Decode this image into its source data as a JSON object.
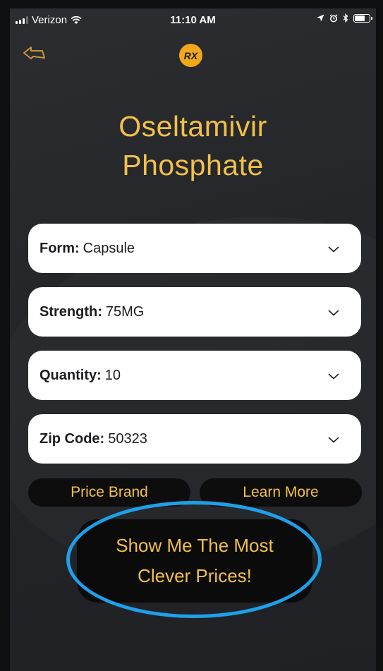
{
  "status_bar": {
    "carrier": "Verizon",
    "time": "11:10 AM"
  },
  "header": {
    "logo_text": "RX"
  },
  "drug": {
    "title_line1": "Oseltamivir",
    "title_line2": "Phosphate"
  },
  "fields": [
    {
      "label": "Form:",
      "value": "Capsule"
    },
    {
      "label": "Strength:",
      "value": "75MG"
    },
    {
      "label": "Quantity:",
      "value": "10"
    },
    {
      "label": "Zip Code:",
      "value": "50323"
    }
  ],
  "buttons": {
    "price_brand": "Price Brand",
    "learn_more": "Learn More",
    "cta_line1": "Show Me The Most",
    "cta_line2": "Clever Prices!"
  },
  "colors": {
    "accent": "#f2c04a",
    "logo": "#f2a71b",
    "highlight_ring": "#1ea0ea",
    "background": "#232528"
  }
}
